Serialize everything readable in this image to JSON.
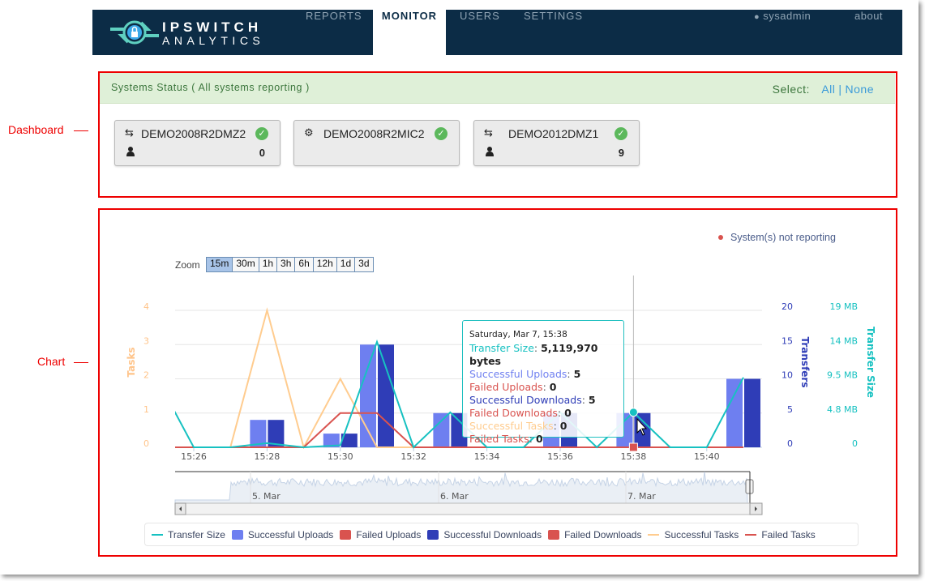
{
  "nav": {
    "logo_line1": "IPSWITCH",
    "logo_line2": "ANALYTICS",
    "items": [
      {
        "label": "REPORTS",
        "active": false
      },
      {
        "label": "MONITOR",
        "active": true
      },
      {
        "label": "USERS",
        "active": false
      },
      {
        "label": "SETTINGS",
        "active": false
      }
    ],
    "user": "sysadmin",
    "about": "about"
  },
  "annotations": {
    "dashboard": "Dashboard",
    "chart": "Chart"
  },
  "status": {
    "title": "Systems Status ( All systems reporting )",
    "select_label": "Select:",
    "select_all": "All",
    "select_sep": "|",
    "select_none": "None"
  },
  "systems": [
    {
      "name": "DEMO2008R2DMZ2",
      "icon": "transfer-arrows-icon",
      "status": "ok",
      "users": "0"
    },
    {
      "name": "DEMO2008R2MIC2",
      "icon": "gears-icon",
      "status": "ok",
      "users": ""
    },
    {
      "name": "DEMO2012DMZ1",
      "icon": "transfer-arrows-icon",
      "status": "ok",
      "users": "9"
    }
  ],
  "not_reporting_label": "System(s) not reporting",
  "zoom": {
    "label": "Zoom",
    "options": [
      "15m",
      "30m",
      "1h",
      "3h",
      "6h",
      "12h",
      "1d",
      "3d"
    ],
    "selected": "15m"
  },
  "tooltip": {
    "date": "Saturday, Mar 7, 15:38",
    "rows": [
      {
        "label": "Transfer Size",
        "value": "5,119,970 bytes",
        "color": "#17c1c1"
      },
      {
        "label": "Successful Uploads",
        "value": "5",
        "color": "#7080f0"
      },
      {
        "label": "Failed Uploads",
        "value": "0",
        "color": "#d9534f"
      },
      {
        "label": "Successful Downloads",
        "value": "5",
        "color": "#2f3db7"
      },
      {
        "label": "Failed Downloads",
        "value": "0",
        "color": "#d9534f"
      },
      {
        "label": "Successful Tasks",
        "value": "0",
        "color": "#ffcc8f"
      },
      {
        "label": "Failed Tasks",
        "value": "0",
        "color": "#d9534f"
      }
    ]
  },
  "chart_data": {
    "type": "bar",
    "x": [
      "15:25",
      "15:26",
      "15:27",
      "15:28",
      "15:29",
      "15:30",
      "15:31",
      "15:32",
      "15:33",
      "15:34",
      "15:35",
      "15:36",
      "15:37",
      "15:38",
      "15:39",
      "15:40",
      "15:41"
    ],
    "x_ticks": [
      "15:26",
      "15:28",
      "15:30",
      "15:32",
      "15:34",
      "15:36",
      "15:38",
      "15:40"
    ],
    "axes": {
      "tasks": {
        "title": "Tasks",
        "ticks": [
          "0",
          "1",
          "2",
          "3",
          "4"
        ],
        "range": [
          0,
          4
        ],
        "color": "#ffc48a"
      },
      "transfers": {
        "title": "Transfers",
        "ticks": [
          "0",
          "5",
          "10",
          "15",
          "20"
        ],
        "range": [
          0,
          20
        ],
        "color": "#2f3db7"
      },
      "transfer_size": {
        "title": "Transfer Size",
        "ticks": [
          "0",
          "4.8 MB",
          "9.5 MB",
          "14 MB",
          "19 MB"
        ],
        "range_bytes": [
          0,
          20000000
        ],
        "color": "#17c1c1"
      }
    },
    "series": [
      {
        "name": "Transfer Size",
        "kind": "line",
        "axis": "transfer_size",
        "color": "#17c1c1",
        "values": [
          10000000,
          0,
          0,
          600000,
          0,
          300000,
          15400000,
          0,
          5100000,
          0,
          0,
          5100000,
          0,
          5119970,
          0,
          0,
          10200000
        ]
      },
      {
        "name": "Successful Uploads",
        "kind": "column",
        "axis": "transfers",
        "color": "#6e7ff0",
        "values": [
          0,
          0,
          0,
          4,
          0,
          2,
          15,
          0,
          5,
          0,
          0,
          5,
          0,
          5,
          0,
          0,
          10
        ]
      },
      {
        "name": "Failed Uploads",
        "kind": "column",
        "axis": "transfers",
        "color": "#d9534f",
        "values": [
          0,
          0,
          0,
          0,
          0,
          0,
          0,
          0,
          0,
          0,
          0,
          0,
          0,
          0,
          0,
          0,
          0
        ]
      },
      {
        "name": "Successful Downloads",
        "kind": "column",
        "axis": "transfers",
        "color": "#2f3db7",
        "values": [
          0,
          0,
          0,
          4,
          0,
          2,
          15,
          0,
          5,
          0,
          0,
          5,
          0,
          5,
          0,
          0,
          10
        ]
      },
      {
        "name": "Failed Downloads",
        "kind": "column",
        "axis": "transfers",
        "color": "#d9534f",
        "values": [
          0,
          0,
          0,
          0,
          0,
          0,
          0,
          0,
          0,
          0,
          0,
          0,
          0,
          0,
          0,
          0,
          0
        ]
      },
      {
        "name": "Successful Tasks",
        "kind": "line",
        "axis": "tasks",
        "color": "#ffcc8f",
        "values": [
          0,
          0,
          0,
          4,
          0,
          2,
          0,
          0,
          0,
          0,
          0,
          0,
          0,
          0,
          0,
          0,
          0
        ]
      },
      {
        "name": "Failed Tasks",
        "kind": "line",
        "axis": "tasks",
        "color": "#d9534f",
        "values": [
          0,
          0,
          0,
          0,
          0,
          1,
          1,
          0,
          0,
          0,
          0,
          0,
          0,
          0,
          0,
          0,
          0
        ]
      }
    ],
    "hovered": "15:38",
    "grid": true,
    "legend": "bottom",
    "navigator": {
      "labels": [
        "5. Mar",
        "6. Mar",
        "7. Mar"
      ]
    }
  }
}
